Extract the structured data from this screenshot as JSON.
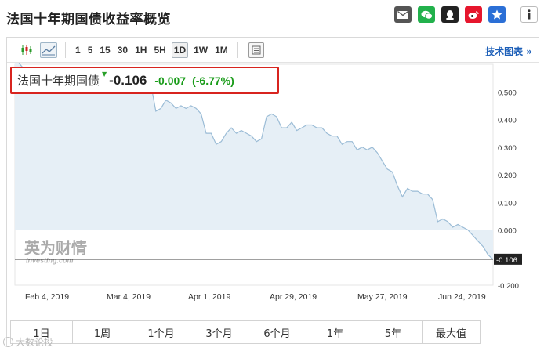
{
  "page": {
    "title": "法国十年期国债收益率概览"
  },
  "share": {
    "buttons": [
      {
        "name": "email-icon",
        "color": "#555555"
      },
      {
        "name": "wechat-icon",
        "color": "#22b14c"
      },
      {
        "name": "qq-icon",
        "color": "#222222"
      },
      {
        "name": "weibo-icon",
        "color": "#e6162d"
      },
      {
        "name": "qzone-icon",
        "color": "#2b6fd6"
      },
      {
        "name": "info-icon",
        "color": "#555555"
      }
    ]
  },
  "toolbar": {
    "timeframes": [
      "1",
      "5",
      "15",
      "30",
      "1H",
      "5H",
      "1D",
      "1W",
      "1M"
    ],
    "active_timeframe": "1D",
    "tech_link": "技术图表 »"
  },
  "quote": {
    "name": "法国十年期国债",
    "price": "-0.106",
    "change": "-0.007",
    "change_pct": "(-6.77%)",
    "up_color": "#1a9c1a"
  },
  "watermark_logo": {
    "text": "英为财情",
    "sub": "Investing.com"
  },
  "chart_data": {
    "type": "area",
    "x_tick_labels": [
      "Feb 4, 2019",
      "Mar 4, 2019",
      "Apr 1, 2019",
      "Apr 29, 2019",
      "May 27, 2019",
      "Jun 24, 2019"
    ],
    "y_tick_labels": [
      "0.500",
      "0.400",
      "0.300",
      "0.200",
      "0.100",
      "0.000",
      "-0.100",
      "-0.200"
    ],
    "ylim": [
      -0.2,
      0.6
    ],
    "current_value_label": "-0.106",
    "current_value": -0.106,
    "series": [
      {
        "values": [
          0.62,
          0.6,
          0.58,
          0.58,
          0.56,
          0.57,
          0.58,
          0.57,
          0.56,
          0.55,
          0.57,
          0.57,
          0.55,
          0.54,
          0.54,
          0.55,
          0.54,
          0.53,
          0.55,
          0.56,
          0.54,
          0.54,
          0.53,
          0.55,
          0.56,
          0.58,
          0.56,
          0.53,
          0.43,
          0.44,
          0.47,
          0.46,
          0.44,
          0.45,
          0.44,
          0.45,
          0.44,
          0.42,
          0.35,
          0.35,
          0.31,
          0.32,
          0.35,
          0.37,
          0.35,
          0.36,
          0.35,
          0.34,
          0.32,
          0.33,
          0.41,
          0.42,
          0.41,
          0.37,
          0.37,
          0.39,
          0.36,
          0.37,
          0.38,
          0.38,
          0.37,
          0.37,
          0.35,
          0.34,
          0.34,
          0.31,
          0.32,
          0.32,
          0.29,
          0.3,
          0.29,
          0.3,
          0.28,
          0.25,
          0.22,
          0.21,
          0.16,
          0.12,
          0.15,
          0.14,
          0.14,
          0.13,
          0.13,
          0.11,
          0.03,
          0.04,
          0.03,
          0.01,
          0.02,
          0.01,
          0.0,
          -0.02,
          -0.04,
          -0.06,
          -0.09,
          -0.106
        ]
      }
    ],
    "colors": {
      "line": "#9bbcd6",
      "fill": "#e6eff6",
      "zero_line": "#000000",
      "label_bg": "#222222"
    }
  },
  "ranges": [
    "1日",
    "1周",
    "1个月",
    "3个月",
    "6个月",
    "1年",
    "5年",
    "最大值"
  ],
  "watermark": {
    "text": "大数论投"
  }
}
